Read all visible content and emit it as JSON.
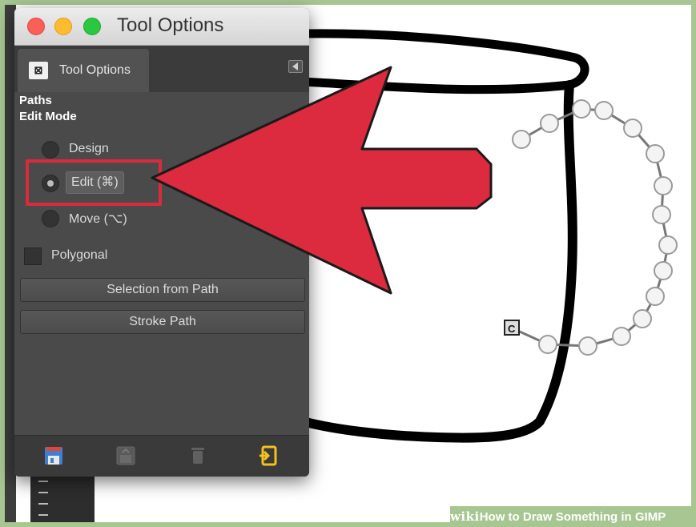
{
  "window": {
    "title": "Tool Options",
    "tab_label": "Tool Options",
    "tab_icon_glyph": "⊠"
  },
  "tool_options": {
    "section_title": "Paths",
    "edit_mode_label": "Edit Mode",
    "modes": [
      {
        "label": "Design",
        "selected": false
      },
      {
        "label": "Edit (⌘)",
        "selected": true
      },
      {
        "label": "Move (⌥)",
        "selected": false
      }
    ],
    "polygonal_label": "Polygonal",
    "polygonal_checked": false,
    "selection_from_path_label": "Selection from Path",
    "stroke_path_label": "Stroke Path"
  },
  "bottom_bar": {
    "icons": [
      "save-icon",
      "restore-icon",
      "delete-icon",
      "reset-icon"
    ]
  },
  "annotation": {
    "arrow_color": "#dc2a3f",
    "highlight_color": "#d92b3d"
  },
  "canvas": {
    "path_anchor_glyph": "C"
  },
  "watermark": {
    "brand": "wiki",
    "text": "How to Draw Something in GIMP"
  }
}
